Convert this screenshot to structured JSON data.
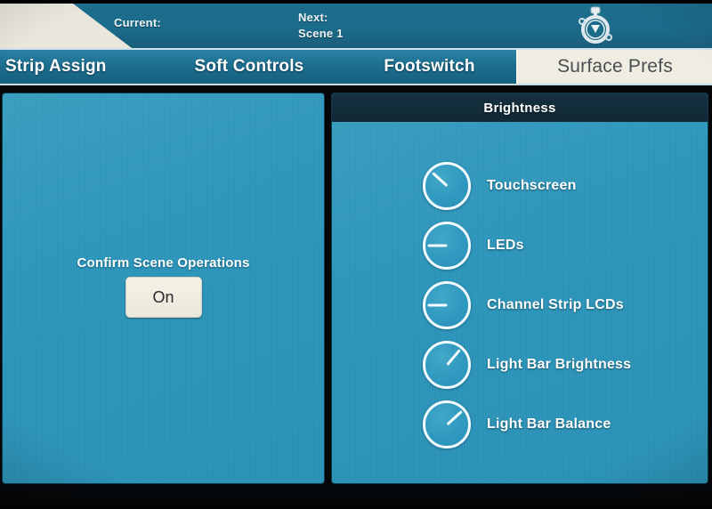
{
  "statusbar": {
    "current_label": "Current:",
    "next_label": "Next:",
    "next_value": "Scene 1",
    "timer_icon": "stopwatch-icon"
  },
  "tabs": [
    {
      "label": "Strip Assign",
      "active": false
    },
    {
      "label": "Soft Controls",
      "active": false
    },
    {
      "label": "Footswitch",
      "active": false
    },
    {
      "label": "Surface Prefs",
      "active": true
    }
  ],
  "left_panel": {
    "setting_label": "Confirm Scene Operations",
    "toggle_value": "On"
  },
  "right_panel": {
    "header": "Brightness",
    "knobs": [
      {
        "label": "Touchscreen",
        "angle": -48
      },
      {
        "label": "LEDs",
        "angle": -90
      },
      {
        "label": "Channel Strip LCDs",
        "angle": -90
      },
      {
        "label": "Light Bar Brightness",
        "angle": 40
      },
      {
        "label": "Light Bar Balance",
        "angle": 48
      }
    ]
  },
  "colors": {
    "panel_blue": "#2e98bd",
    "topbar_blue": "#1b6b8a",
    "tabbar_blue": "#1d6f91",
    "active_tab_cream": "#efece1",
    "header_navy": "#142e3d",
    "text_white": "#ffffff",
    "active_tab_text": "#4b4f52"
  }
}
